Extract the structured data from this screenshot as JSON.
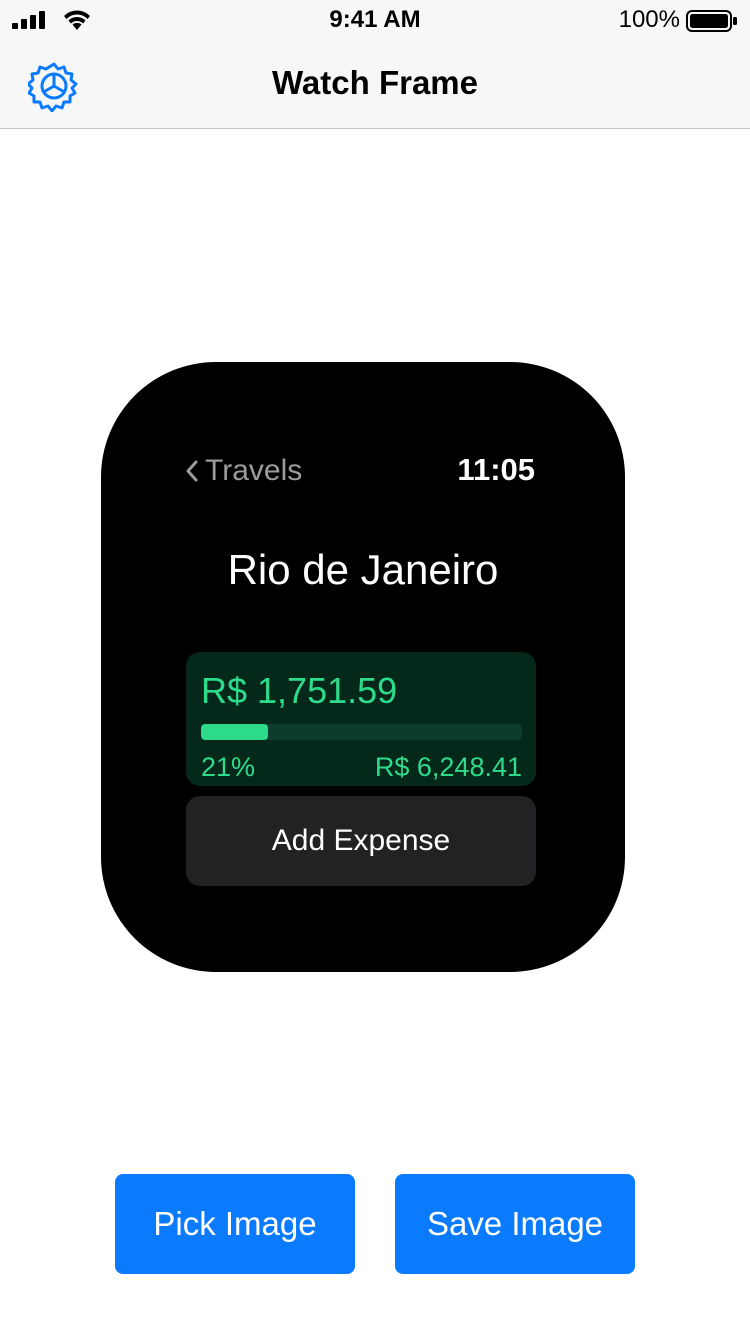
{
  "status_bar": {
    "time": "9:41 AM",
    "battery_percent": "100%",
    "battery_level": 1.0
  },
  "nav": {
    "title": "Watch Frame",
    "left_icon": "gear-icon"
  },
  "watch": {
    "back_label": "Travels",
    "time": "11:05",
    "title": "Rio de Janeiro",
    "spent": "R$ 1,751.59",
    "progress_percent": "21%",
    "progress_fraction": 0.21,
    "remaining": "R$ 6,248.41",
    "add_expense_label": "Add Expense"
  },
  "buttons": {
    "pick_image": "Pick Image",
    "save_image": "Save Image"
  },
  "colors": {
    "accent": "#0a7aff",
    "money_green": "#2edb8a",
    "card_bg": "#04291b"
  }
}
